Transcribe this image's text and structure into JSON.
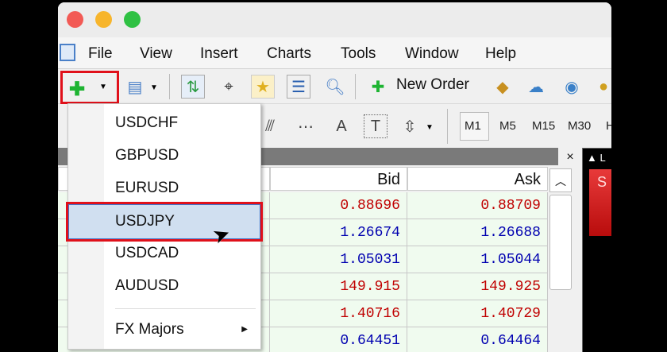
{
  "menubar": {
    "items": [
      "File",
      "View",
      "Insert",
      "Charts",
      "Tools",
      "Window",
      "Help"
    ]
  },
  "toolbar": {
    "new_order": "New Order"
  },
  "timeframes": [
    "M1",
    "M5",
    "M15",
    "M30",
    "H"
  ],
  "market_watch": {
    "columns": [
      "Bid",
      "Ask"
    ],
    "rows": [
      {
        "bid": "0.88696",
        "ask": "0.88709",
        "color": "#c00000"
      },
      {
        "bid": "1.26674",
        "ask": "1.26688",
        "color": "#0000b0"
      },
      {
        "bid": "1.05031",
        "ask": "1.05044",
        "color": "#0000b0"
      },
      {
        "bid": "149.915",
        "ask": "149.925",
        "color": "#c00000"
      },
      {
        "bid": "1.40716",
        "ask": "1.40729",
        "color": "#c00000"
      },
      {
        "bid": "0.64451",
        "ask": "0.64464",
        "color": "#0000b0"
      }
    ]
  },
  "dropdown": {
    "items": [
      "USDCHF",
      "GBPUSD",
      "EURUSD",
      "USDJPY",
      "USDCAD",
      "AUDUSD"
    ],
    "selected": "USDJPY",
    "submenu": "FX Majors"
  },
  "chart_panel": {
    "button_letter": "S",
    "label": "L"
  },
  "colors": {
    "highlight": "#d0dff0",
    "red_box": "#e0101a"
  }
}
